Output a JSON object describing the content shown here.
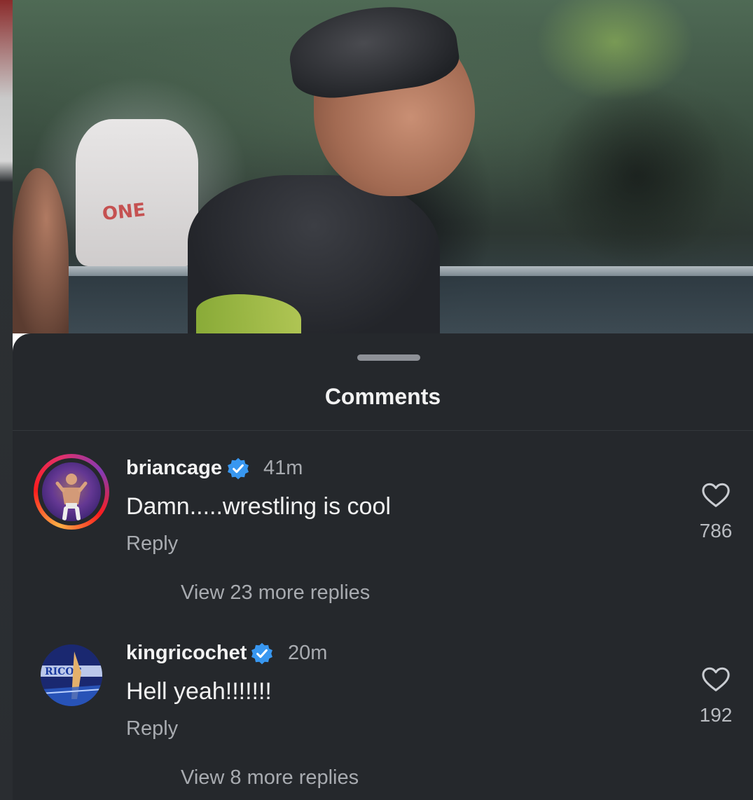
{
  "sheet": {
    "title": "Comments"
  },
  "comments": [
    {
      "username": "briancage",
      "verified": true,
      "time": "41m",
      "text": "Damn.....wrestling is cool",
      "reply_label": "Reply",
      "likes": "786",
      "view_replies": "View 23 more replies",
      "has_story_ring": true
    },
    {
      "username": "kingricochet",
      "verified": true,
      "time": "20m",
      "text": "Hell yeah!!!!!!!",
      "reply_label": "Reply",
      "likes": "192",
      "view_replies": "View 8 more replies",
      "has_story_ring": false
    }
  ],
  "video": {
    "shirt_text": "ONE"
  },
  "colors": {
    "sheet_bg": "#25282c",
    "verified_blue": "#3897f0",
    "text_primary": "#f2f2f2",
    "text_secondary": "#a8abb0"
  }
}
